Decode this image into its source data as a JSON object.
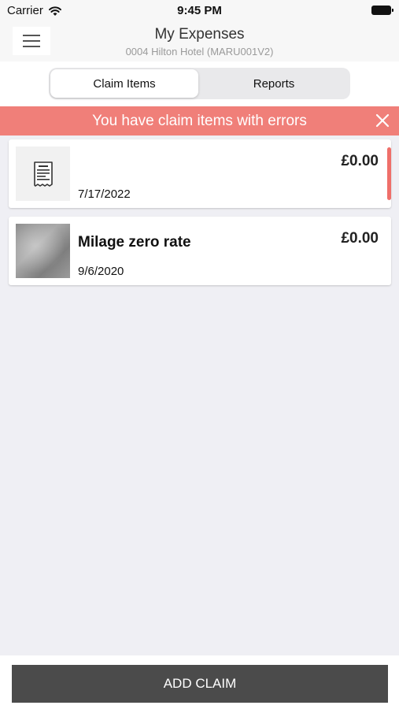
{
  "status_bar": {
    "carrier": "Carrier",
    "time": "9:45 PM",
    "wifi_icon": "wifi-icon",
    "battery_icon": "battery-icon"
  },
  "nav": {
    "title": "My Expenses",
    "subtitle": "0004 Hilton Hotel (MARU001V2)",
    "menu_icon": "hamburger-menu-icon"
  },
  "tabs": [
    {
      "label": "Claim Items",
      "selected": true
    },
    {
      "label": "Reports",
      "selected": false
    }
  ],
  "error_banner": {
    "text": "You have claim items with errors",
    "close_icon": "close-icon",
    "color": "#f07f79"
  },
  "claim_items": [
    {
      "title": "",
      "date": "7/17/2022",
      "amount": "£0.00",
      "thumbnail": "receipt-icon",
      "has_error": true
    },
    {
      "title": "Milage zero rate",
      "date": "9/6/2020",
      "amount": "£0.00",
      "thumbnail": "photo",
      "has_error": false
    }
  ],
  "footer": {
    "add_claim_label": "ADD CLAIM"
  }
}
